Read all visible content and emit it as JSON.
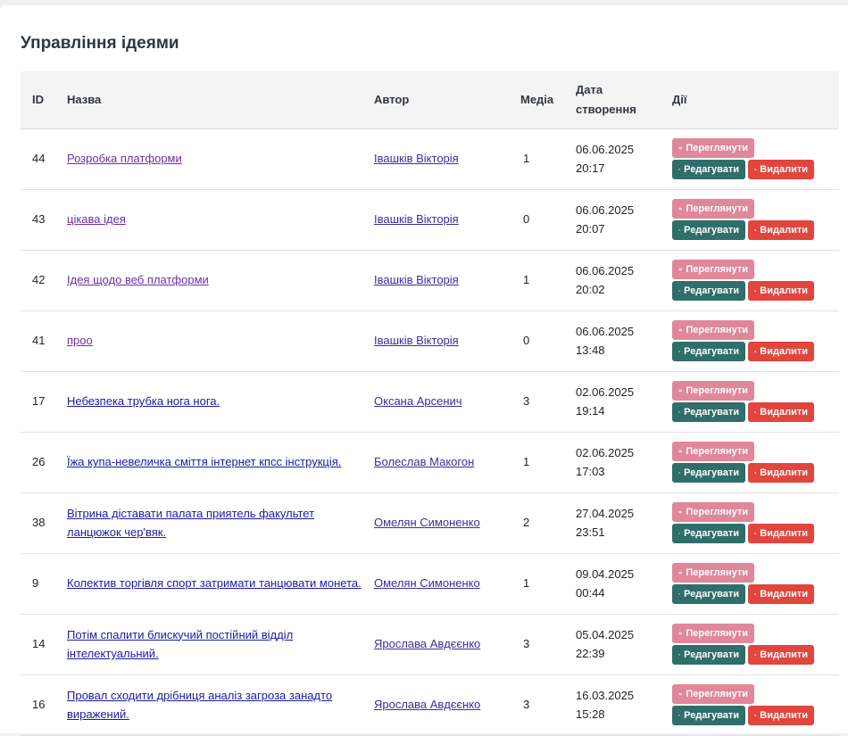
{
  "page": {
    "title": "Управління ідеями"
  },
  "table": {
    "headers": {
      "id": "ID",
      "title": "Назва",
      "author": "Автор",
      "media": "Медіа",
      "created": "Дата створення",
      "actions": "Дії"
    },
    "buttons": {
      "view": "Переглянути",
      "edit": "Редагувати",
      "delete": "Видалити"
    },
    "rows": [
      {
        "id": "44",
        "title": "Розробка платформи",
        "author": "Івашків Вікторія",
        "media": "1",
        "date": "06.06.2025",
        "time": "20:17"
      },
      {
        "id": "43",
        "title": "цікава ідея",
        "author": "Івашків Вікторія",
        "media": "0",
        "date": "06.06.2025",
        "time": "20:07"
      },
      {
        "id": "42",
        "title": "Ідея щодо веб платформи",
        "author": "Івашків Вікторія",
        "media": "1",
        "date": "06.06.2025",
        "time": "20:02"
      },
      {
        "id": "41",
        "title": "проо",
        "author": "Івашків Вікторія",
        "media": "0",
        "date": "06.06.2025",
        "time": "13:48"
      },
      {
        "id": "17",
        "title": "Небезпека трубка нога нога.",
        "author": "Оксана Арсенич",
        "media": "3",
        "date": "02.06.2025",
        "time": "19:14"
      },
      {
        "id": "26",
        "title": "Їжа купа-невеличка сміття інтернет кпсс інструкція.",
        "author": "Болеслав Макогон",
        "media": "1",
        "date": "02.06.2025",
        "time": "17:03"
      },
      {
        "id": "38",
        "title": "Вітрина діставати палата приятель факультет ланцюжок чер'вяк.",
        "author": "Омелян Симоненко",
        "media": "2",
        "date": "27.04.2025",
        "time": "23:51"
      },
      {
        "id": "9",
        "title": "Колектив торгівля спорт затримати танцювати монета.",
        "author": "Омелян Симоненко",
        "media": "1",
        "date": "09.04.2025",
        "time": "00:44"
      },
      {
        "id": "14",
        "title": "Потім спалити блискучий постійний відділ інтелектуальний.",
        "author": "Ярослава Авдєєнко",
        "media": "3",
        "date": "05.04.2025",
        "time": "22:39"
      },
      {
        "id": "16",
        "title": "Провал сходити дрібниця аналіз загроза занадто виражений.",
        "author": "Ярослава Авдєєнко",
        "media": "3",
        "date": "16.03.2025",
        "time": "15:28"
      }
    ]
  }
}
